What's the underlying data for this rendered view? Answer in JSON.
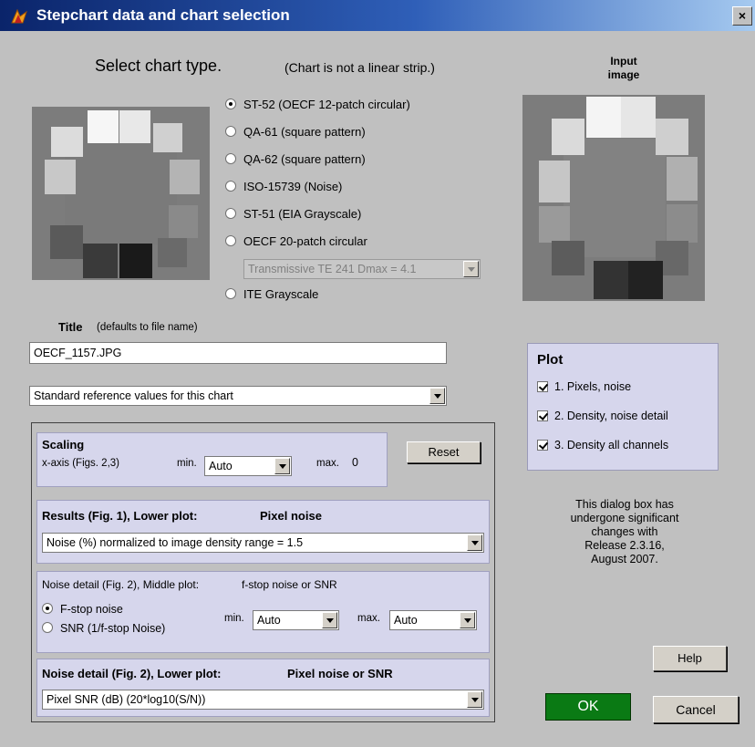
{
  "window": {
    "title": "Stepchart data and chart selection",
    "close_glyph": "×"
  },
  "chart_select": {
    "heading": "Select chart type.",
    "note": "(Chart is not a linear strip.)",
    "input_image_label_line1": "Input",
    "input_image_label_line2": "image",
    "options": [
      {
        "label": "ST-52 (OECF 12-patch circular)",
        "selected": true
      },
      {
        "label": "QA-61 (square pattern)",
        "selected": false
      },
      {
        "label": "QA-62 (square pattern)",
        "selected": false
      },
      {
        "label": "ISO-15739 (Noise)",
        "selected": false
      },
      {
        "label": "ST-51 (EIA Grayscale)",
        "selected": false
      },
      {
        "label": "OECF 20-patch circular",
        "selected": false
      },
      {
        "label": "ITE Grayscale",
        "selected": false
      }
    ],
    "transmissive_select": "Transmissive TE 241 Dmax = 4.1"
  },
  "title_field": {
    "label": "Title",
    "hint": "(defaults to file name)",
    "value": "OECF_1157.JPG"
  },
  "reference_select": "Standard reference values for this chart",
  "scaling": {
    "heading": "Scaling",
    "xaxis_label": "x-axis (Figs. 2,3)",
    "min_label": "min.",
    "min_value": "Auto",
    "max_label": "max.",
    "max_value": "0",
    "reset_label": "Reset"
  },
  "results": {
    "heading": "Results (Fig. 1), Lower plot:",
    "heading_value": "Pixel noise",
    "select": "Noise (%) normalized to image density range = 1.5"
  },
  "noise_detail": {
    "heading": "Noise detail (Fig. 2), Middle plot:",
    "heading_value": "f-stop noise or SNR",
    "option_fstop": "F-stop noise",
    "option_snr": "SNR (1/f-stop Noise)",
    "min_label": "min.",
    "min_value": "Auto",
    "max_label": "max.",
    "max_value": "Auto"
  },
  "noise_lower": {
    "heading": "Noise detail (Fig. 2), Lower plot:",
    "heading_value": "Pixel noise or SNR",
    "select": "Pixel SNR (dB)  (20*log10(S/N))"
  },
  "plot": {
    "heading": "Plot",
    "items": [
      {
        "label": "1. Pixels, noise",
        "checked": true
      },
      {
        "label": "2. Density, noise detail",
        "checked": true
      },
      {
        "label": "3. Density all channels",
        "checked": true
      }
    ]
  },
  "notice": {
    "line1": "This dialog box has",
    "line2": "undergone significant",
    "line3": "changes with",
    "line4": "Release 2.3.16,",
    "line5": "August 2007."
  },
  "buttons": {
    "help": "Help",
    "ok": "OK",
    "cancel": "Cancel"
  },
  "colors": {
    "ok_green": "#0a7a14",
    "panel_lavender": "#d6d6ec",
    "titlebar_blue": "#0a246a"
  }
}
